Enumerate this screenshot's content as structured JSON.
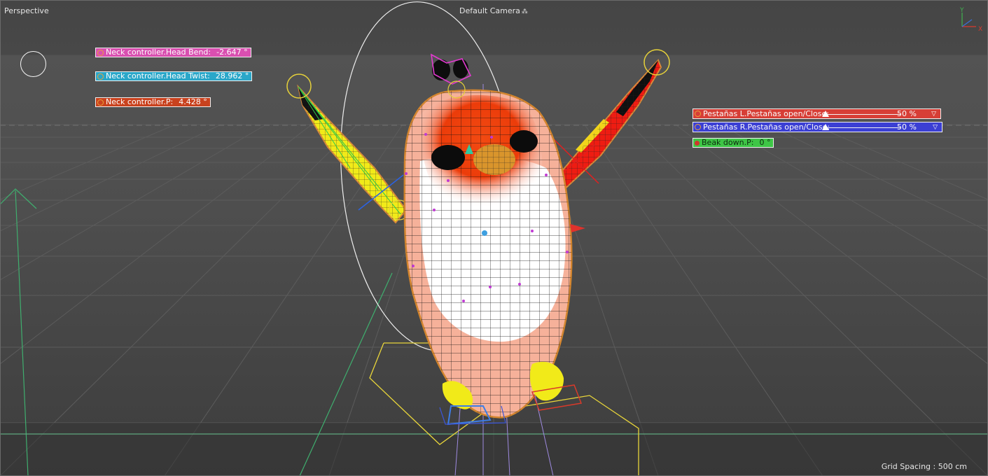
{
  "viewport": {
    "view_name": "Perspective",
    "camera_name": "Default Camera",
    "camera_icon": "camera-dots-icon",
    "grid_spacing": "Grid Spacing : 500 cm",
    "axis": {
      "y_label": "Y",
      "x_label": "X"
    }
  },
  "hud": {
    "head_bend": {
      "label": "Neck controller.Head Bend:",
      "value": "-2.647 °",
      "color": "#d94fb0"
    },
    "head_twist": {
      "label": "Neck controller.Head Twist:",
      "value": "28.962 °",
      "color": "#2aa7c9"
    },
    "neck_p": {
      "label": "Neck controller.P:",
      "value": "4.428 °",
      "color": "#c9421e"
    },
    "lashes_l": {
      "label": "Pestañas L.Pestañas open/Close:",
      "value": 0.5,
      "value_text": "50 %",
      "color": "#d73e36"
    },
    "lashes_r": {
      "label": "Pestañas R.Pestañas open/Close:",
      "value": 0.5,
      "value_text": "50 %",
      "color": "#3b3fd4"
    },
    "beak_down": {
      "label": "Beak down.P:",
      "value": "0 °",
      "color": "#3ec646"
    }
  }
}
